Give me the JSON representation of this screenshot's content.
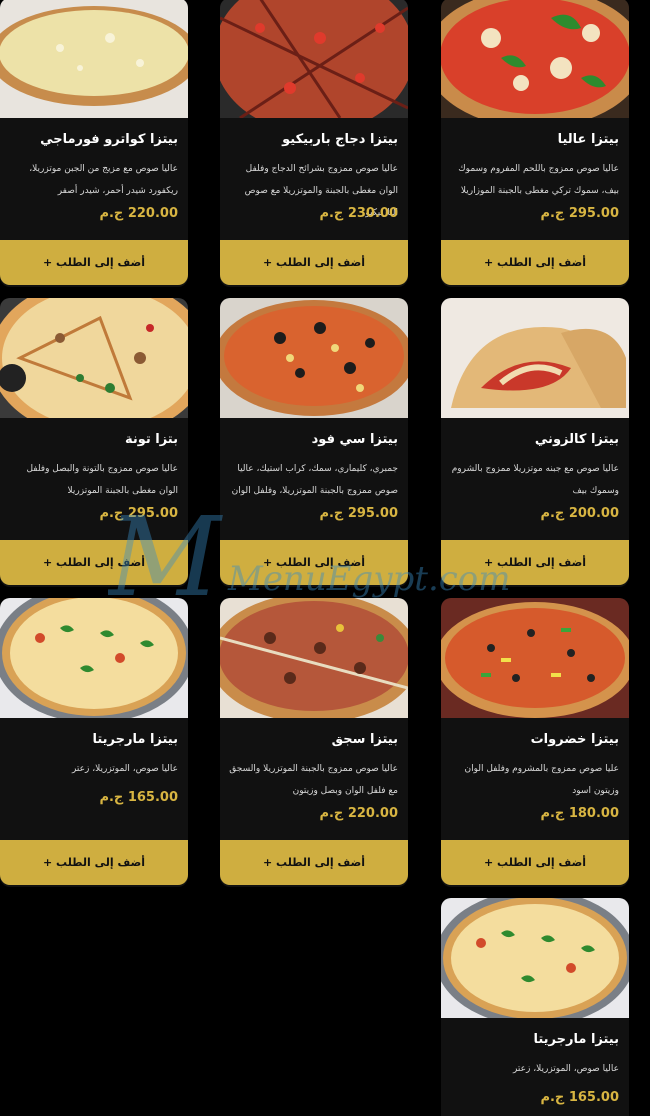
{
  "cards": [
    {
      "title": "بيتزا عاليا",
      "desc": "عاليا صوص ممزوج باللحم المفروم وسموك بيف، سموك تركي مغطى بالجبنة الموزاريلا",
      "price": "295.00 ج.م",
      "button": "أضف إلى الطلب +",
      "image": "pizza-alia-image"
    },
    {
      "title": "بيتزا دجاج باربيكيو",
      "desc": "عاليا صوص ممزوج بشرائح الدجاج وفلفل الوان مغطى بالجبنة والموتزريلا مع صوص الباربيكيو",
      "price": "230.00 ج.م",
      "button": "أضف إلى الطلب +",
      "image": "pizza-bbq-chicken-image"
    },
    {
      "title": "بيتزا كواترو فورماجي",
      "desc": "عاليا صوص مع مزيج من الجبن موتزريلا، ريكفورد شيدر أحمر، شيدر أصفر",
      "price": "220.00 ج.م",
      "button": "أضف إلى الطلب +",
      "image": "pizza-quattro-formaggi-image"
    },
    {
      "title": "بيتزا كالزوني",
      "desc": "عاليا صوص مع جبنه موتزريلا ممزوج بالشروم وسموك بيف",
      "price": "200.00 ج.م",
      "button": "أضف إلى الطلب +",
      "image": "pizza-calzone-image"
    },
    {
      "title": "بيتزا سي فود",
      "desc": "جمبري، كليماري، سمك، كراب استيك، عاليا صوص ممزوج بالجبنة الموتزريلا، وفلفل الوان",
      "price": "295.00 ج.م",
      "button": "أضف إلى الطلب +",
      "image": "pizza-seafood-image"
    },
    {
      "title": "بتزا تونة",
      "desc": "عاليا صوص ممزوج بالتونة والبصل وفلفل الوان مغطى بالجبنة الموتزريلا",
      "price": "295.00 ج.م",
      "button": "أضف إلى الطلب +",
      "image": "pizza-tuna-image"
    },
    {
      "title": "بيتزا خضروات",
      "desc": "عليا صوص ممزوج بالمشروم وفلفل الوان وزيتون اسود",
      "price": "180.00 ج.م",
      "button": "أضف إلى الطلب +",
      "image": "pizza-vegetables-image"
    },
    {
      "title": "بيتزا سجق",
      "desc": "عاليا صوص ممزوج بالجبنة الموتزريلا والسجق مع فلفل الوان وبصل وزيتون",
      "price": "220.00 ج.م",
      "button": "أضف إلى الطلب +",
      "image": "pizza-sausage-image"
    },
    {
      "title": "بيتزا مارجريتا",
      "desc": "عاليا صوص، الموتزريلا، زعتر",
      "price": "165.00 ج.م",
      "button": "أضف إلى الطلب +",
      "image": "pizza-margherita-image"
    },
    {
      "title": "بيتزا مارجريتا",
      "desc": "عاليا صوص، الموتزريلا، زعتر",
      "price": "165.00 ج.م",
      "button": "",
      "image": "pizza-margherita-image"
    }
  ],
  "watermark": "MenuEgypt.com",
  "colors": {
    "background": "#000000",
    "card": "#111111",
    "accent": "#cfae40",
    "price": "#d8b542"
  }
}
